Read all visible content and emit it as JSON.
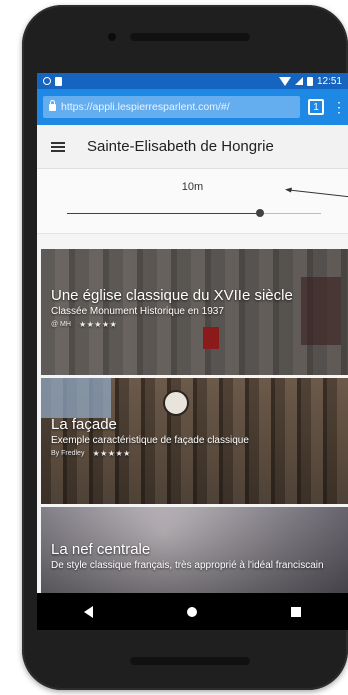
{
  "status_bar": {
    "time": "12:51"
  },
  "browser": {
    "url": "https://appli.lespierresparlent.com/#/",
    "tab_count": "1",
    "menu_glyph": "⋮"
  },
  "app": {
    "title": "Sainte-Elisabeth de Hongrie"
  },
  "slider": {
    "value_label": "10m",
    "value_fraction": 0.76
  },
  "cards": [
    {
      "title": "Une église classique du XVIIe siècle",
      "subtitle": "Classée Monument Historique en 1937",
      "meta": "@ MH",
      "stars": "★★★★★"
    },
    {
      "title": "La façade",
      "subtitle": "Exemple caractéristique de façade classique",
      "meta": "By Fredley",
      "stars": "★★★★★"
    },
    {
      "title": "La nef centrale",
      "subtitle": "De style classique français, très approprié à l'idéal franciscain",
      "meta": "",
      "stars": ""
    }
  ]
}
